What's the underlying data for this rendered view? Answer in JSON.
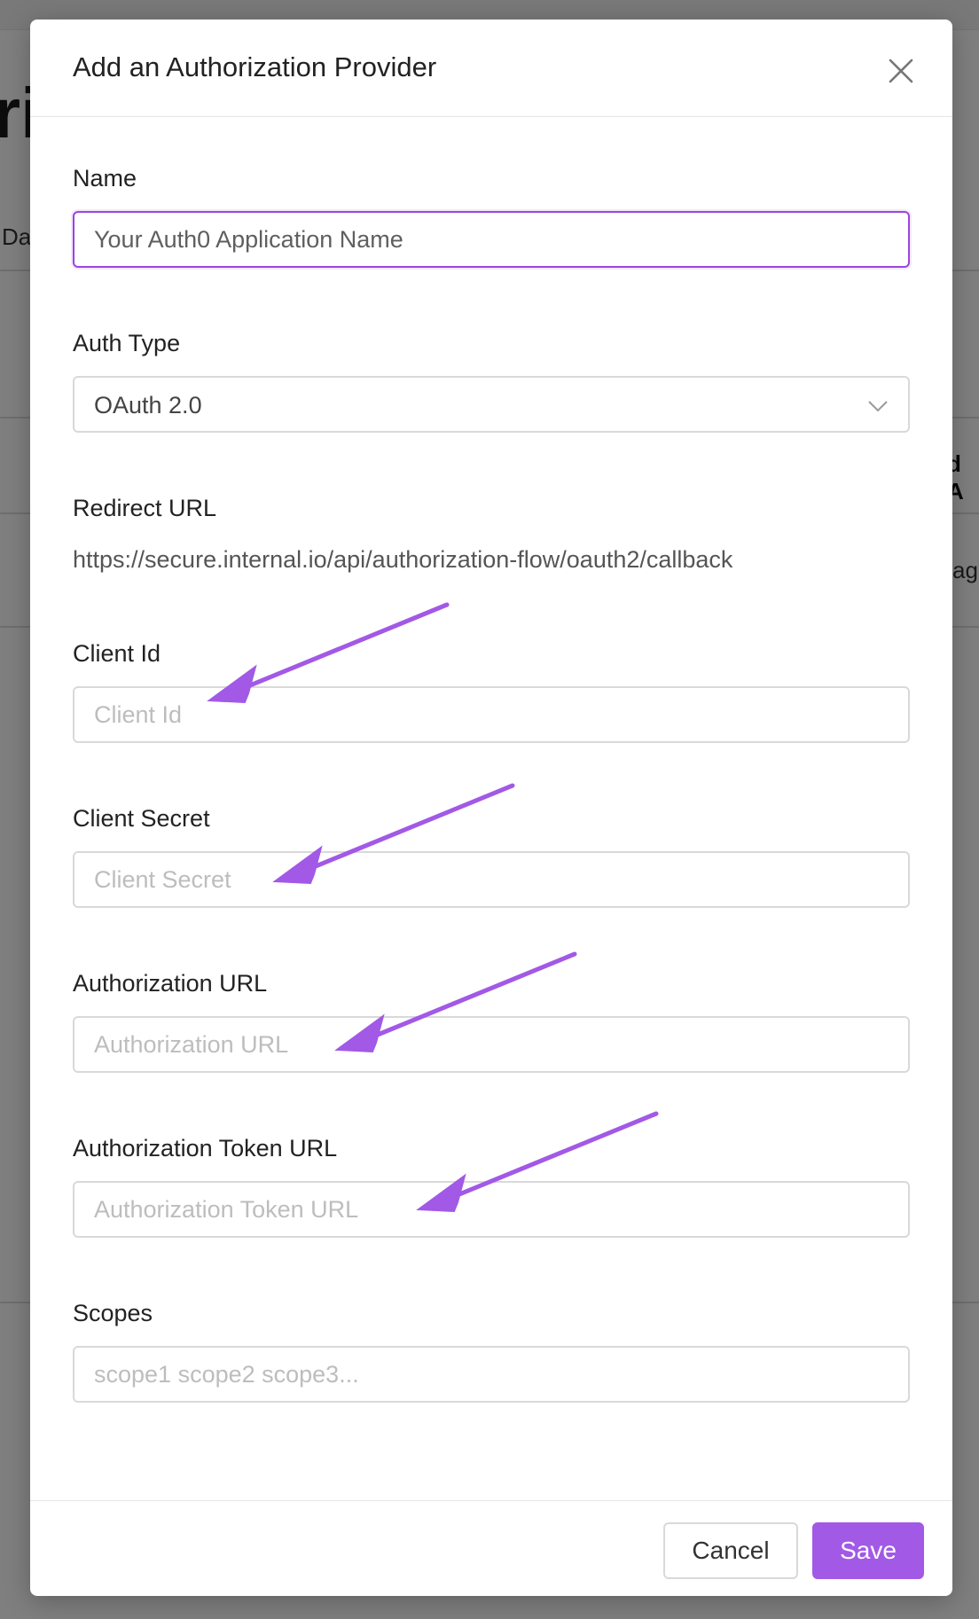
{
  "background": {
    "title_fragment": "riz",
    "tab_fragment": "Da",
    "column_header_fragment": "d A",
    "cell_fragment": "ag"
  },
  "modal": {
    "title": "Add an Authorization Provider",
    "close_icon": "close-icon",
    "fields": {
      "name": {
        "label": "Name",
        "value": "",
        "placeholder": "Your Auth0 Application Name"
      },
      "auth_type": {
        "label": "Auth Type",
        "selected": "OAuth 2.0",
        "icon": "chevron-down-icon"
      },
      "redirect_url": {
        "label": "Redirect URL",
        "value": "https://secure.internal.io/api/authorization-flow/oauth2/callback"
      },
      "client_id": {
        "label": "Client Id",
        "value": "",
        "placeholder": "Client Id"
      },
      "client_secret": {
        "label": "Client Secret",
        "value": "",
        "placeholder": "Client Secret"
      },
      "authorization_url": {
        "label": "Authorization URL",
        "value": "",
        "placeholder": "Authorization URL"
      },
      "authorization_token_url": {
        "label": "Authorization Token URL",
        "value": "",
        "placeholder": "Authorization Token URL"
      },
      "scopes": {
        "label": "Scopes",
        "value": "",
        "placeholder": "scope1 scope2 scope3..."
      }
    },
    "footer": {
      "cancel_label": "Cancel",
      "save_label": "Save"
    }
  },
  "colors": {
    "accent": "#a259e6",
    "focus_border": "#9b45e0",
    "annotation_arrow": "#a259e6"
  }
}
